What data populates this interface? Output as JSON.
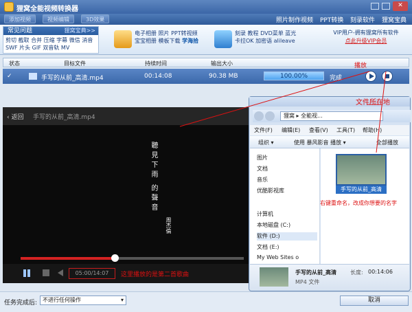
{
  "app": {
    "title": "狸窝全能视频转换器"
  },
  "toolbar": {
    "buttons": [
      "添加视频",
      "视频编辑",
      "3D效果"
    ],
    "links": [
      "照片制作视频",
      "PPT转换",
      "刻录软件",
      "狸窝宝典"
    ]
  },
  "faq": {
    "title": "常见问题",
    "more": "狸窝宝典>>",
    "tags": "剪切 截取 合并 压缩 字幕 微信 消音 SWF 片头 GIF 双音轨 MV"
  },
  "features": {
    "group1": [
      "电子相册",
      "照片 PPT转视频",
      "宝宝相册",
      "模板下载",
      "学海拾"
    ],
    "group2": [
      "刻录",
      "教程",
      "DVD菜单",
      "蓝光",
      "卡拉OK",
      "加密语",
      "alileave"
    ]
  },
  "vip": {
    "line1": "VIP用户-拥有狸窝所有软件",
    "line2": "点此升级VIP会员"
  },
  "list": {
    "headers": [
      "状态",
      "目标文件",
      "持续时间",
      "输出大小"
    ],
    "row": {
      "file": "手写的从前_高清.mp4",
      "duration": "00:14:08",
      "size": "90.38 MB",
      "progress": "100.00%",
      "status": "完成"
    }
  },
  "annotations": {
    "play": "播放",
    "folder": "文件所在地",
    "rename": "右键重命名，改成你想要的名字",
    "track": "这里播放的是第二首歌曲"
  },
  "player": {
    "back": "返回",
    "filename": "手写的从前_高清.mp4",
    "lyrics": [
      "聽見",
      "下",
      "雨",
      "的",
      "聲",
      "音"
    ],
    "credit": "周杰倫",
    "time": "05:00/14:07",
    "progress": 0.42
  },
  "explorer": {
    "address": [
      "狸窝",
      "全能视..."
    ],
    "menu": [
      "文件(F)",
      "编辑(E)",
      "查看(V)",
      "工具(T)",
      "帮助(H)"
    ],
    "commands": [
      "组织",
      "使用 暴风影音 播放",
      "全部播放"
    ],
    "nav": [
      "图片",
      "文档",
      "音乐",
      "优酷影视库",
      "计算机",
      "本地磁盘 (C:)",
      "软件 (D:)",
      "文档 (E:)",
      "My Web Sites o"
    ],
    "file_label": "手写的从前_高清",
    "details": {
      "name": "手写的从前_高清",
      "type": "MP4 文件",
      "length_label": "长度:",
      "length": "00:14:06"
    }
  },
  "bottom": {
    "label": "任务完成后:",
    "option": "不进行任何操作",
    "cancel": "取消"
  }
}
